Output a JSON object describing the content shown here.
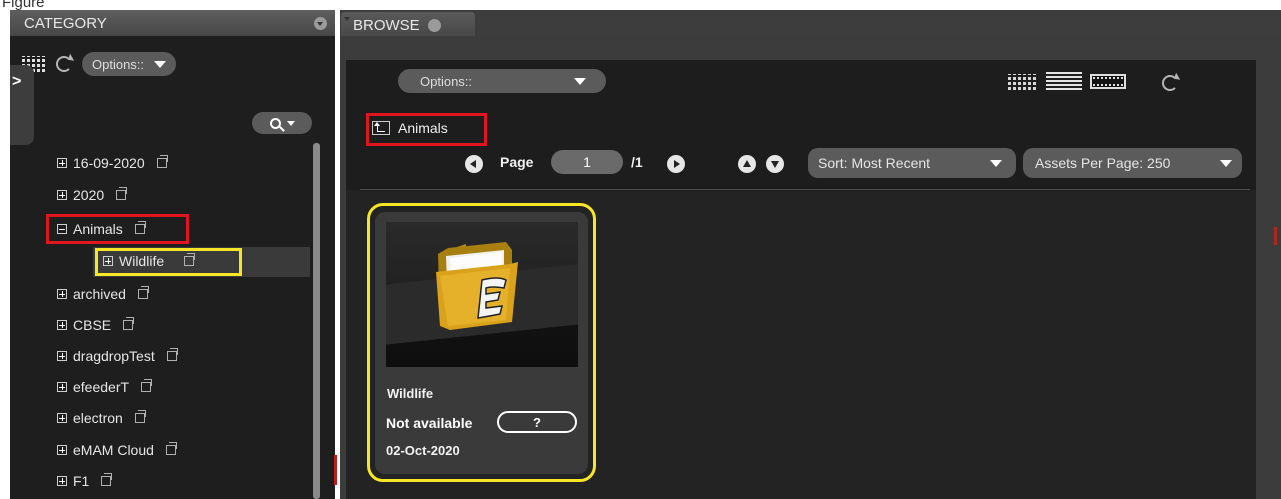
{
  "caption": "Figure",
  "category_panel": {
    "title": "CATEGORY",
    "options_label": "Options::",
    "side_tab_label": ">",
    "tree": [
      {
        "label": "16-09-2020",
        "state": "collapsed"
      },
      {
        "label": "2020",
        "state": "collapsed"
      },
      {
        "label": "Animals",
        "state": "expanded",
        "highlight": "red"
      },
      {
        "label": "Wildlife",
        "state": "collapsed",
        "child": true,
        "selected": true,
        "highlight": "yellow"
      },
      {
        "label": "archived",
        "state": "collapsed"
      },
      {
        "label": "CBSE",
        "state": "collapsed"
      },
      {
        "label": "dragdropTest",
        "state": "collapsed"
      },
      {
        "label": "efeederT",
        "state": "collapsed"
      },
      {
        "label": "electron",
        "state": "collapsed"
      },
      {
        "label": "eMAM Cloud",
        "state": "collapsed"
      },
      {
        "label": "F1",
        "state": "collapsed"
      }
    ]
  },
  "browse_panel": {
    "tab_label": "BROWSE",
    "options_label": "Options::",
    "breadcrumb": "Animals",
    "page_label": "Page",
    "page_value": "1",
    "page_total": "/1",
    "sort_label": "Sort: Most Recent",
    "assets_per_page_label": "Assets Per Page: 250",
    "card": {
      "title": "Wildlife",
      "status": "Not available",
      "status_button": "?",
      "date": "02-Oct-2020",
      "icon": "folder-icon"
    }
  },
  "colors": {
    "highlight_red": "#e0151f",
    "highlight_yellow": "#f7e625",
    "panel_bg": "#1e1e1e",
    "folder": "#d9a21a"
  }
}
